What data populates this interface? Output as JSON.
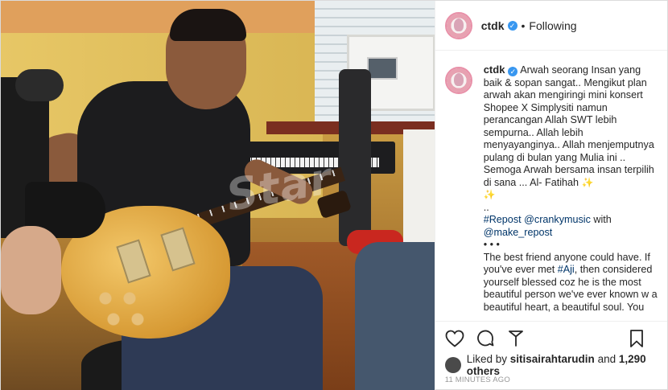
{
  "post": {
    "watermark": "Star",
    "header": {
      "username": "ctdk",
      "verified_mark": "✓",
      "separator": "•",
      "follow_status": "Following"
    },
    "caption": {
      "username": "ctdk",
      "text_1": "Arwah seorang Insan yang baik & sopan sangat.. Mengikut plan arwah akan mengiringi mini konsert Shopee X Simplysiti namun perancangan Allah SWT lebih sempurna.. Allah lebih menyayanginya.. Allah menjemputnya pulang di bulan yang Mulia ini .. Semoga Arwah bersama insan terpilih di sana ... Al- Fatihah",
      "sparkle": "✨",
      "ellipsis": "..",
      "repost_tag": "#Repost",
      "repost_mention": "@crankymusic",
      "with": "with",
      "make_repost": "@make_repost",
      "bullets": "• • •",
      "text_2a": "The best friend anyone could have. If you've ever met",
      "hashtag_aji": "#Aji",
      "text_2b": ", then considered yourself blessed coz he is the most beautiful person we've ever known w a beautiful heart, a beautiful soul. You"
    },
    "likes": {
      "prefix": "Liked by",
      "user": "sitisairahtarudin",
      "middle": "and",
      "count": "1,290 others"
    },
    "timestamp": "11 MINUTES AGO",
    "icons": {
      "like": "heart-icon",
      "comment": "comment-icon",
      "share": "share-icon",
      "save": "bookmark-icon"
    }
  }
}
